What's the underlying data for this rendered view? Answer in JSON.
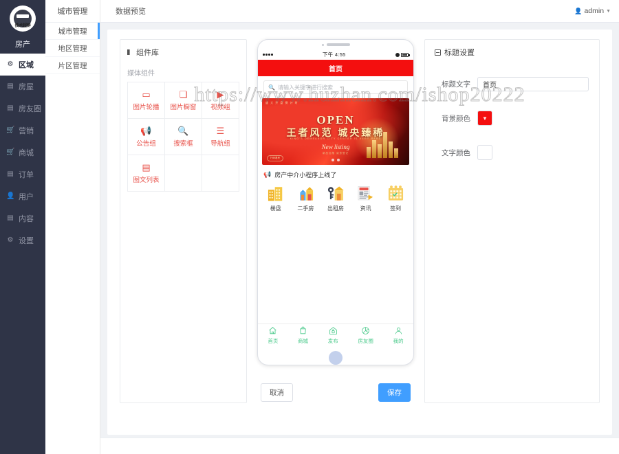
{
  "sidebar": {
    "brand_label": "房产",
    "items": [
      {
        "label": "区域",
        "icon": "gear-icon",
        "active": true
      },
      {
        "label": "房屋",
        "icon": "book-icon",
        "active": false
      },
      {
        "label": "房友圈",
        "icon": "book-icon",
        "active": false
      },
      {
        "label": "营销",
        "icon": "cart-icon",
        "active": false
      },
      {
        "label": "商城",
        "icon": "cart-icon",
        "active": false
      },
      {
        "label": "订单",
        "icon": "list-icon",
        "active": false
      },
      {
        "label": "用户",
        "icon": "user-icon",
        "active": false
      },
      {
        "label": "内容",
        "icon": "book-icon",
        "active": false
      },
      {
        "label": "设置",
        "icon": "gear-icon",
        "active": false
      }
    ]
  },
  "subnav": {
    "header": "城市管理",
    "items": [
      {
        "label": "城市管理",
        "active": true
      },
      {
        "label": "地区管理",
        "active": false
      },
      {
        "label": "片区管理",
        "active": false
      }
    ]
  },
  "topbar": {
    "tabs": [
      {
        "label": "数据预览",
        "active": true
      }
    ],
    "admin_label": "admin"
  },
  "library": {
    "title": "组件库",
    "group_label": "媒体组件",
    "items": [
      {
        "label": "图片轮播",
        "icon": "image-carousel-icon",
        "glyph": "▭"
      },
      {
        "label": "图片橱窗",
        "icon": "image-gallery-icon",
        "glyph": "❏"
      },
      {
        "label": "视频组",
        "icon": "video-icon",
        "glyph": "▶"
      },
      {
        "label": "公告组",
        "icon": "megaphone-icon",
        "glyph": "📢"
      },
      {
        "label": "搜索框",
        "icon": "search-icon",
        "glyph": "🔍"
      },
      {
        "label": "导航组",
        "icon": "list-nav-icon",
        "glyph": "☰"
      },
      {
        "label": "图文列表",
        "icon": "article-list-icon",
        "glyph": "▤"
      }
    ]
  },
  "phone": {
    "status": {
      "time": "下午 4:55"
    },
    "header_title": "首页",
    "header_bg": "#f40f0f",
    "header_text_color": "#ffffff",
    "search_placeholder": "请输入关键字进行搜索",
    "banner": {
      "tag": "盛 大 开 盘 倒 计 时",
      "open": "OPEN",
      "main": "王者风范  城央臻稀",
      "sub": "KING'S DEMEANOR CITY CENTER IS VERY RARE",
      "new_listing": "New listing",
      "new_listing_sub": "新品加推  诚意登记",
      "badge": "扫码看房",
      "dots": 2
    },
    "announcement": "房产中介小程序上线了",
    "nav_items": [
      {
        "label": "楼盘",
        "icon": "building-icon"
      },
      {
        "label": "二手房",
        "icon": "house-keys-icon"
      },
      {
        "label": "出租房",
        "icon": "rent-key-icon"
      },
      {
        "label": "资讯",
        "icon": "news-icon"
      },
      {
        "label": "签到",
        "icon": "calendar-icon"
      }
    ],
    "tabbar": [
      {
        "label": "首页",
        "icon": "home-icon",
        "glyph": "⌂"
      },
      {
        "label": "商城",
        "icon": "bag-icon",
        "glyph": "🛍"
      },
      {
        "label": "发布",
        "icon": "publish-icon",
        "glyph": "⌂"
      },
      {
        "label": "房友圈",
        "icon": "circle-icon",
        "glyph": "◉"
      },
      {
        "label": "我的",
        "icon": "person-icon",
        "glyph": "☻"
      }
    ],
    "tabbar_color": "#49c98a"
  },
  "actions": {
    "cancel_label": "取消",
    "save_label": "保存"
  },
  "settings": {
    "title": "标题设置",
    "fields": [
      {
        "label": "标题文字",
        "type": "text",
        "value": "首页"
      },
      {
        "label": "背景颜色",
        "type": "color",
        "value": "#f40f0f"
      },
      {
        "label": "文字颜色",
        "type": "color",
        "value": "#ffffff"
      }
    ]
  },
  "watermark": {
    "text": "https://www.huzhan.com/ishop20222"
  }
}
